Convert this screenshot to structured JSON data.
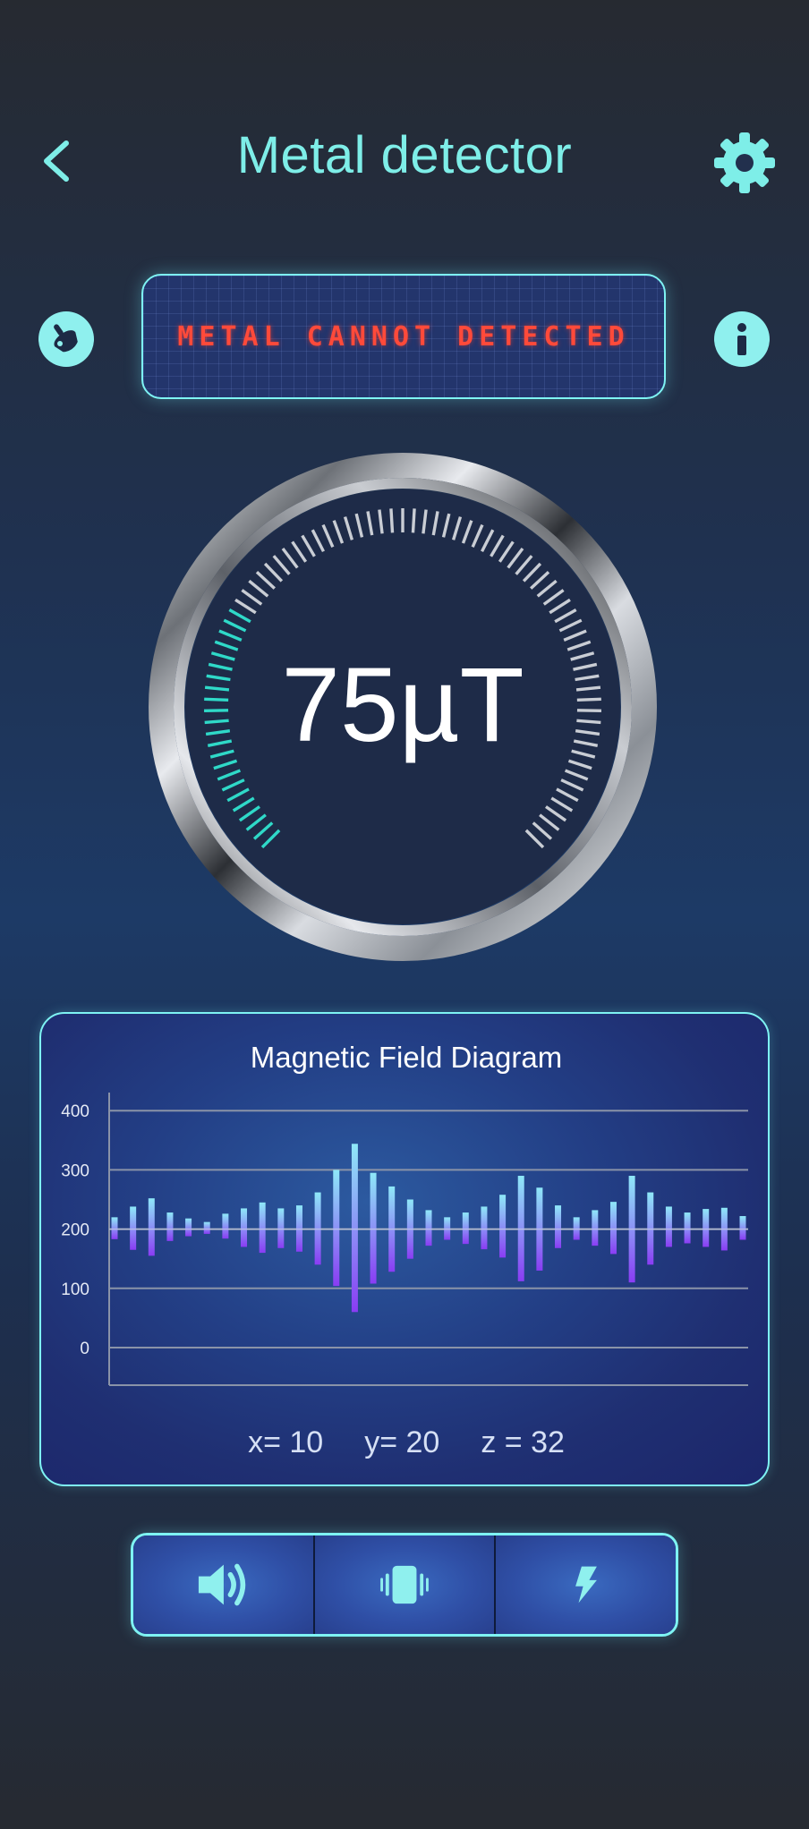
{
  "header": {
    "title": "Metal detector",
    "back_icon": "chevron-left-icon",
    "settings_icon": "gear-icon"
  },
  "status": {
    "message": "METAL CANNOT DETECTED",
    "left_icon": "brush-icon",
    "right_icon": "info-icon"
  },
  "gauge": {
    "value_text": "75µT",
    "level_fraction": 0.28
  },
  "chart_data": {
    "type": "bar",
    "title": "Magnetic Field Diagram",
    "baseline": 200,
    "ylim": [
      -60,
      400
    ],
    "y_ticks": [
      "400",
      "300",
      "200",
      "100",
      "0"
    ],
    "series": [
      {
        "values": [
          [
            183,
            220
          ],
          [
            165,
            238
          ],
          [
            155,
            252
          ],
          [
            180,
            228
          ],
          [
            188,
            218
          ],
          [
            192,
            212
          ],
          [
            184,
            226
          ],
          [
            170,
            235
          ],
          [
            160,
            245
          ],
          [
            168,
            235
          ],
          [
            162,
            240
          ],
          [
            140,
            262
          ],
          [
            104,
            300
          ],
          [
            60,
            344
          ],
          [
            108,
            295
          ],
          [
            128,
            272
          ],
          [
            150,
            250
          ],
          [
            172,
            232
          ],
          [
            182,
            220
          ],
          [
            175,
            228
          ],
          [
            166,
            238
          ],
          [
            152,
            258
          ],
          [
            112,
            290
          ],
          [
            130,
            270
          ],
          [
            168,
            240
          ],
          [
            182,
            220
          ],
          [
            172,
            232
          ],
          [
            158,
            246
          ],
          [
            110,
            290
          ],
          [
            140,
            262
          ],
          [
            170,
            238
          ],
          [
            176,
            228
          ],
          [
            170,
            234
          ],
          [
            164,
            236
          ],
          [
            182,
            222
          ]
        ]
      }
    ],
    "colors": {
      "top": "#8ee8f8",
      "bottom": "#8a3cf4"
    }
  },
  "readout": {
    "x": "x= 10",
    "y": "y= 20",
    "z": "z = 32"
  },
  "controls": {
    "sound_icon": "speaker-icon",
    "vibrate_icon": "vibrate-icon",
    "flash_icon": "flash-icon"
  },
  "colors": {
    "accent": "#7eeee8",
    "warning": "#ff4a3a"
  }
}
